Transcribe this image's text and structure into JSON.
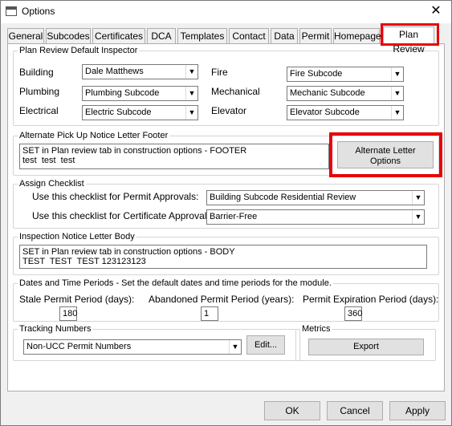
{
  "window": {
    "title": "Options"
  },
  "tabs": [
    {
      "label": "General"
    },
    {
      "label": "Subcodes"
    },
    {
      "label": "Certificates"
    },
    {
      "label": "DCA"
    },
    {
      "label": "Templates"
    },
    {
      "label": "Contact"
    },
    {
      "label": "Data"
    },
    {
      "label": "Permit"
    },
    {
      "label": "Homepage"
    },
    {
      "label": "Plan Review",
      "active": true
    }
  ],
  "inspector": {
    "legend": "Plan Review Default Inspector",
    "building": {
      "label": "Building",
      "value": "Dale Matthews"
    },
    "plumbing": {
      "label": "Plumbing",
      "value": "Plumbing Subcode"
    },
    "electrical": {
      "label": "Electrical",
      "value": "Electric Subcode"
    },
    "fire": {
      "label": "Fire",
      "value": "Fire Subcode"
    },
    "mechanical": {
      "label": "Mechanical",
      "value": "Mechanic Subcode"
    },
    "elevator": {
      "label": "Elevator",
      "value": "Elevator Subcode"
    }
  },
  "footer": {
    "legend": "Alternate Pick Up Notice Letter Footer",
    "text": "SET in Plan review tab in construction options - FOOTER\ntest  test  test",
    "button_label": "Alternate Letter\nOptions"
  },
  "checklist": {
    "legend": "Assign Checklist",
    "permit_label": "Use this checklist for Permit Approvals:",
    "permit_value": "Building Subcode Residential Review",
    "cert_label": "Use this checklist for Certificate Approvals:",
    "cert_value": "Barrier-Free"
  },
  "body_letter": {
    "legend": "Inspection Notice Letter Body",
    "text": "SET in Plan review tab in construction options - BODY\nTEST  TEST  TEST 123123123"
  },
  "periods": {
    "legend": "Dates and Time Periods - Set the default dates and time periods for the module.",
    "stale_label": "Stale Permit Period (days):",
    "stale_value": "180",
    "abandoned_label": "Abandoned Permit Period (years):",
    "abandoned_value": "1",
    "expiration_label": "Permit Expiration Period (days):",
    "expiration_value": "360"
  },
  "tracking": {
    "legend": "Tracking Numbers",
    "value": "Non-UCC Permit Numbers",
    "edit_label": "Edit..."
  },
  "metrics": {
    "legend": "Metrics",
    "export_label": "Export"
  },
  "buttons": {
    "ok": "OK",
    "cancel": "Cancel",
    "apply": "Apply"
  },
  "colors": {
    "highlight": "#e8000b",
    "window_bg": "#f0f0f0"
  }
}
